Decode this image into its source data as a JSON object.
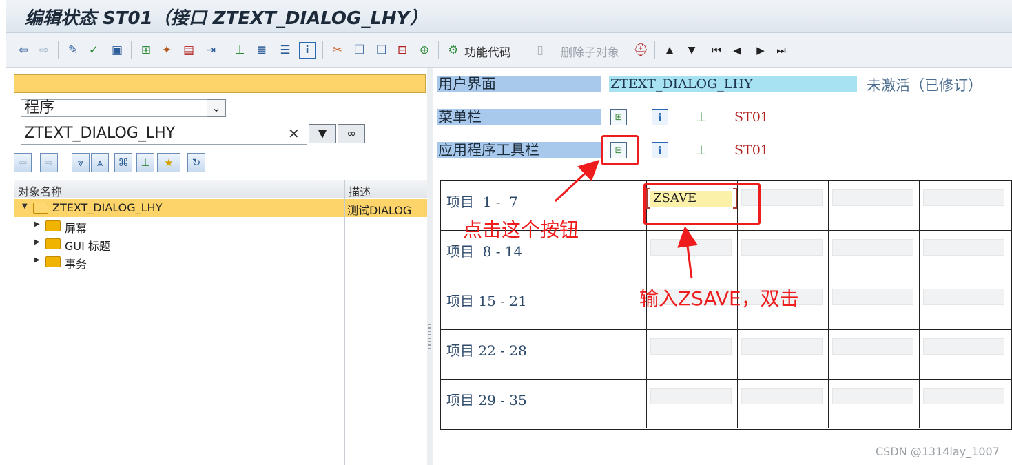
{
  "window": {
    "title": "编辑状态 ST01（接口 ZTEXT_DIALOG_LHY）"
  },
  "toolbar": {
    "function_code_label": "功能代码",
    "delete_subobject_label": "删除子对象",
    "icons": [
      "back-icon",
      "forward-icon",
      "other-object-icon",
      "check-icon",
      "activate-icon",
      "where-used-icon",
      "display-object-list-icon",
      "wizard-icon",
      "hierarchy-icon",
      "navigate-icon",
      "tree-icon",
      "align-icon",
      "list-icon",
      "info-icon",
      "cut-icon",
      "copy-icon",
      "paste-icon",
      "insert-icon",
      "delete-row-icon",
      "function-code-icon",
      "new-document-icon",
      "hat-icon",
      "up-icon",
      "down-icon",
      "first-page-icon",
      "previous-page-icon",
      "next-page-icon",
      "last-page-icon"
    ]
  },
  "navigator": {
    "object_type": "程序",
    "object_name": "ZTEXT_DIALOG_LHY",
    "clear_symbol": "✕",
    "tree_header": {
      "name": "对象名称",
      "description": "描述"
    },
    "tree_rows": [
      {
        "label": "ZTEXT_DIALOG_LHY",
        "description": "测试DIALOG",
        "selected": true,
        "expanded": true
      },
      {
        "label": "屏幕",
        "description": ""
      },
      {
        "label": "GUI 标题",
        "description": ""
      },
      {
        "label": "事务",
        "description": ""
      }
    ]
  },
  "editor": {
    "user_interface_label": "用户界面",
    "user_interface_value": "ZTEXT_DIALOG_LHY",
    "status_text": "未激活（已修订）",
    "menu_bar_label": "菜单栏",
    "menu_bar_status": "ST01",
    "app_toolbar_label": "应用程序工具栏",
    "app_toolbar_status": "ST01",
    "item_rows": [
      {
        "label": "项目  1 -  7",
        "cells": [
          "ZSAVE",
          "",
          "",
          ""
        ]
      },
      {
        "label": "项目  8 - 14",
        "cells": [
          "",
          "",
          "",
          ""
        ]
      },
      {
        "label": "项目 15 - 21",
        "cells": [
          "",
          "",
          "",
          ""
        ]
      },
      {
        "label": "项目 22 - 28",
        "cells": [
          "",
          "",
          "",
          ""
        ]
      },
      {
        "label": "项目 29 - 35",
        "cells": [
          "",
          "",
          "",
          ""
        ]
      }
    ]
  },
  "annotations": {
    "click_button": "点击这个按钮",
    "enter_zsave": "输入ZSAVE，双击",
    "color": "#ee1c1c"
  },
  "watermark": "CSDN @1314lay_1007"
}
